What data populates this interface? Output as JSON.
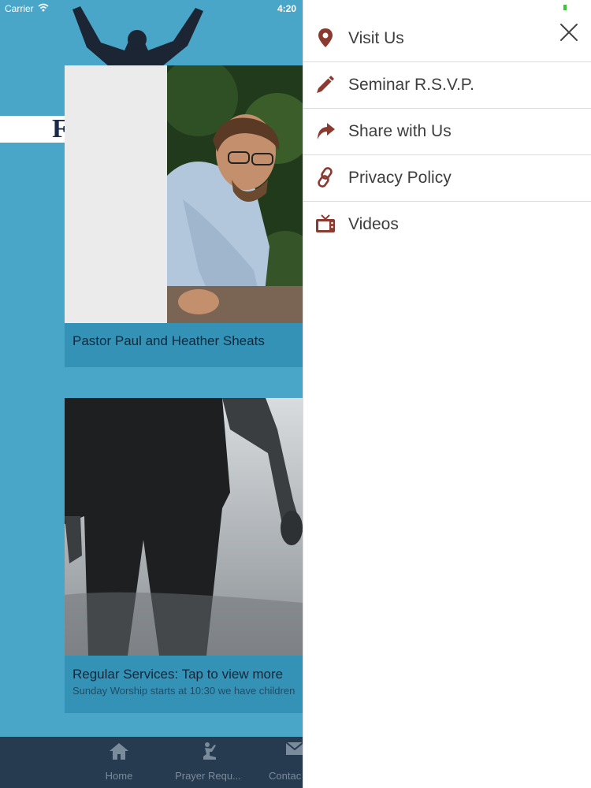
{
  "status_bar": {
    "carrier": "Carrier",
    "time": "4:20"
  },
  "logo_partial": "F",
  "cards": [
    {
      "caption": "Pastor Paul and Heather Sheats"
    },
    {
      "caption": "Regular Services: Tap to view more",
      "subtitle": "Sunday Worship starts at 10:30 we have children"
    }
  ],
  "tabbar": {
    "items": [
      {
        "label": "Home",
        "icon": "home-icon"
      },
      {
        "label": "Prayer Requ...",
        "icon": "praying-icon"
      },
      {
        "label": "Contac",
        "icon": "mail-icon"
      }
    ]
  },
  "drawer": {
    "accent_color": "#8b3a2f",
    "items": [
      {
        "label": "Visit Us",
        "icon": "map-pin-icon"
      },
      {
        "label": "Seminar R.S.V.P.",
        "icon": "pencil-icon"
      },
      {
        "label": "Share with Us",
        "icon": "share-arrow-icon"
      },
      {
        "label": "Privacy Policy",
        "icon": "link-icon"
      },
      {
        "label": "Videos",
        "icon": "tv-icon"
      }
    ]
  }
}
